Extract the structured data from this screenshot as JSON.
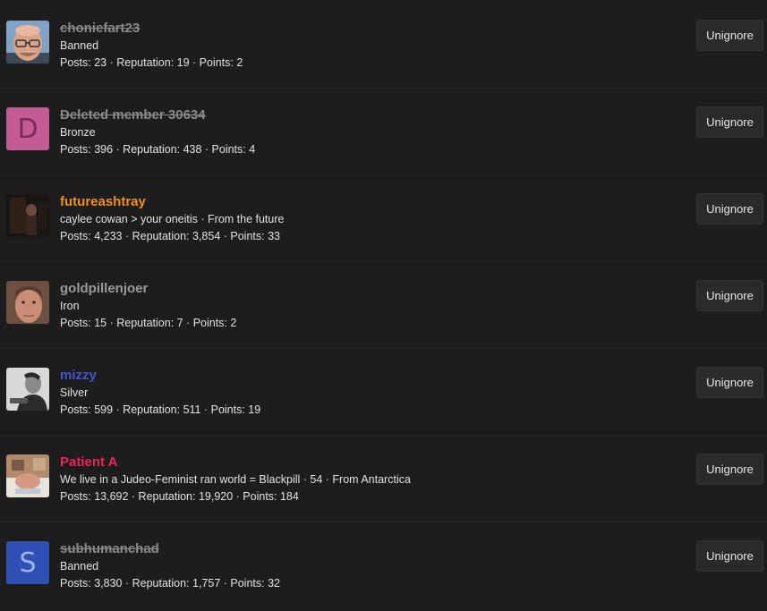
{
  "button_label": "Unignore",
  "members": [
    {
      "username": "choniefart23",
      "banned": true,
      "color": "#8a8a8a",
      "title": "Banned",
      "stats": "Posts: 23 · Reputation: 19 · Points: 2",
      "avatar": {
        "type": "photo",
        "name": "bald-man-glasses-photo"
      }
    },
    {
      "username": "Deleted member 30634",
      "banned": true,
      "color": "#8a8a8a",
      "title": "Bronze",
      "stats": "Posts: 396 · Reputation: 438 · Points: 4",
      "avatar": {
        "type": "letter",
        "letter": "D",
        "bg": "#c45c94",
        "fg": "#7d2a59"
      }
    },
    {
      "username": "futureashtray",
      "banned": false,
      "color": "#f0901c",
      "title": "caylee cowan > your oneitis · From the future",
      "stats": "Posts: 4,233 · Reputation: 3,854 · Points: 33",
      "avatar": {
        "type": "photo",
        "name": "dark-scene-photo"
      }
    },
    {
      "username": "goldpillenjoer",
      "banned": false,
      "color": "#9a9a9a",
      "title": "Iron",
      "stats": "Posts: 15 · Reputation: 7 · Points: 2",
      "avatar": {
        "type": "photo",
        "name": "man-face-photo"
      }
    },
    {
      "username": "mizzy",
      "banned": false,
      "color": "#4557c8",
      "title": "Silver",
      "stats": "Posts: 599 · Reputation: 511 · Points: 19",
      "avatar": {
        "type": "photo",
        "name": "bw-portrait-photo"
      }
    },
    {
      "username": "Patient A",
      "banned": false,
      "color": "#e8265c",
      "title": "We live in a Judeo-Feminist ran world = Blackpill · 54 · From Antarctica",
      "stats": "Posts: 13,692 · Reputation: 19,920 · Points: 184",
      "avatar": {
        "type": "photo",
        "name": "hospital-patient-photo"
      }
    },
    {
      "username": "subhumanchad",
      "banned": true,
      "color": "#8a8a8a",
      "title": "Banned",
      "stats": "Posts: 3,830 · Reputation: 1,757 · Points: 32",
      "avatar": {
        "type": "letter",
        "letter": "S",
        "bg": "#2f4fb5",
        "fg": "#9fb1ea"
      }
    }
  ]
}
